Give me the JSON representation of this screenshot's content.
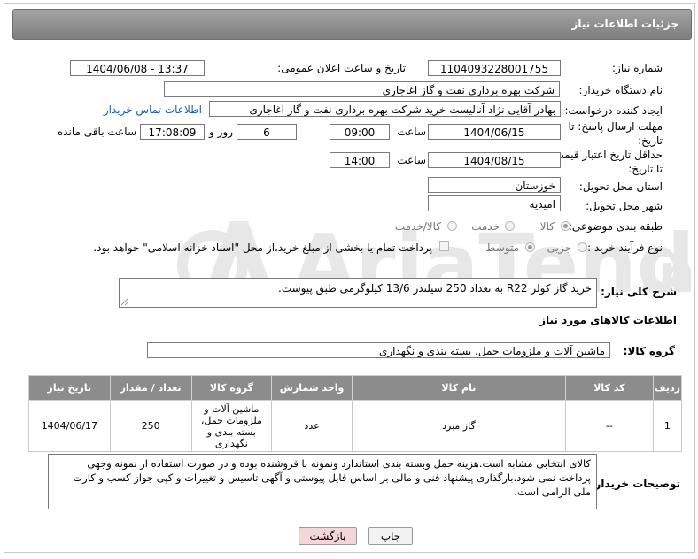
{
  "header": {
    "title": "جزئیات اطلاعات نیاز"
  },
  "fields": {
    "need_number_label": "شماره نیاز:",
    "need_number": "1104093228001755",
    "announce_label": "تاریخ و ساعت اعلان عمومی:",
    "announce_value": "1404/06/08 - 13:37",
    "buyer_org_label": "نام دستگاه خریدار:",
    "buyer_org": "شرکت بهره برداری نفت و گاز اغاجاری",
    "creator_label": "ایجاد کننده درخواست:",
    "creator": "بهادر  آقایی نژاد آنالیست خرید شرکت بهره برداری نفت و گاز اغاجاری",
    "contact_link": "اطلاعات تماس خریدار",
    "deadline_label_1": "مهلت ارسال پاسخ: تا",
    "deadline_label_2": "تاریخ:",
    "deadline_date": "1404/06/15",
    "time_label": "ساعت",
    "deadline_time": "09:00",
    "days_count": "6",
    "days_label": "روز و",
    "remaining_time": "17:08:09",
    "remaining_label": "ساعت باقی مانده",
    "price_validity_label_1": "حداقل تاریخ اعتبار قیمت:",
    "price_validity_label_2": "تا تاریخ:",
    "price_date": "1404/08/15",
    "price_time": "14:00",
    "province_label": "استان محل تحویل:",
    "province": "خوزستان",
    "city_label": "شهر محل تحویل:",
    "city": "امیدیه",
    "category_label": "طبقه بندی موضوعی:",
    "category_options": [
      "کالا",
      "خدمت",
      "کالا/خدمت"
    ],
    "process_label": "نوع فرآیند خرید :",
    "process_options": [
      "جزیی",
      "متوسط"
    ],
    "payment_note": "پرداخت تمام یا بخشی از مبلغ خرید،از محل \"اسناد خزانه اسلامی\" خواهد بود."
  },
  "description": {
    "label": "شرح کلی نیاز:",
    "text": "خرید گاز کولر R22 به تعداد 250 سیلندر 13/6 کیلوگرمی طبق پیوست."
  },
  "goods": {
    "section_title": "اطلاعات کالاهای مورد نیاز",
    "group_label": "گروه کالا:",
    "group_value": "ماشین آلات و ملزومات حمل، بسته بندی و نگهداری",
    "columns": [
      "ردیف",
      "کد کالا",
      "نام کالا",
      "واحد شمارش",
      "گروه کالا",
      "تعداد / مقدار",
      "تاریخ نیاز"
    ],
    "rows": [
      {
        "row": "1",
        "code": "--",
        "name": "گاز مبرد",
        "unit": "عدد",
        "group": "ماشین آلات و ملزومات حمل، بسته بندی و نگهداری",
        "qty": "250",
        "date": "1404/06/17"
      }
    ]
  },
  "buyer_notes": {
    "label": "توضیحات خریدار:",
    "text": "کالای انتخابی مشابه است.هزینه حمل وبسته بندی استاندارد ونمونه با فروشنده بوده و در صورت استفاده از نمونه وجهی پرداخت نمی شود.بارگذاری پیشنهاد فنی و مالی بر اساس فایل پیوستی و آگهی تاسیس و تغییرات و کپی جواز کسب و کارت ملی الزامی است."
  },
  "buttons": {
    "print": "چاپ",
    "back": "بازگشت"
  },
  "colors": {
    "header_bg": "#8c8c8c",
    "link": "#1e5bb5",
    "back_button_bg": "#f5d6d6"
  },
  "icons": [
    "resize-grip-icon"
  ]
}
